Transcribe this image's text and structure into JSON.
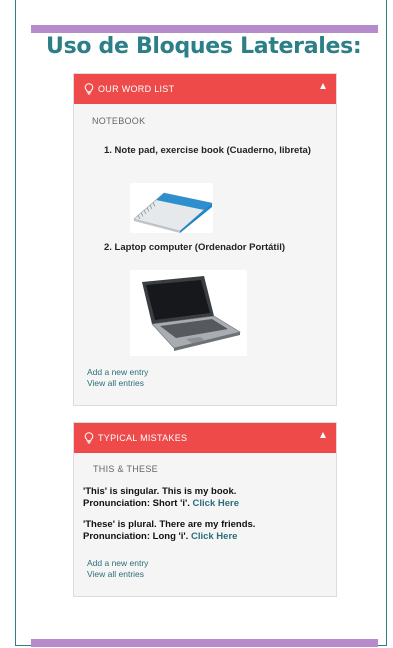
{
  "page": {
    "title": "Uso de Bloques Laterales:",
    "colors": {
      "accent": "#2c7f87",
      "bar": "#b58bcb",
      "header": "#ef4a4a"
    }
  },
  "word_list": {
    "header": "OUR WORD LIST",
    "section": "NOTEBOOK",
    "entries": [
      "1. Note pad, exercise book (Cuaderno, libreta)",
      "2. Laptop computer (Ordenador Portátil)"
    ],
    "add_entry": "Add a new entry",
    "view_all": "View all entries"
  },
  "mistakes": {
    "header": "TYPICAL MISTAKES",
    "section": "THIS & THESE",
    "para1_line1": "'This' is singular. This is my book.",
    "para1_line2": "Pronunciation: Short 'i'.",
    "para2_line1": "'These' is plural. There are my friends.",
    "para2_line2": "Pronunciation: Long 'i'.",
    "click_here": "Click Here",
    "add_entry": "Add a new entry",
    "view_all": "View all entries"
  },
  "icons": {
    "header_icon": "lightbulb-icon",
    "collapse_icon": "chevron-up-icon"
  }
}
